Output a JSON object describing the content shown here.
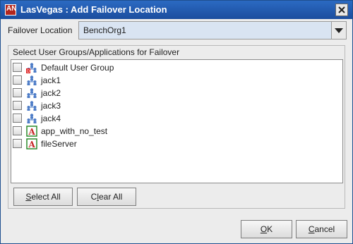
{
  "window": {
    "title": "LasVegas : Add Failover Location",
    "app_icon_letters": "AN"
  },
  "failover_location": {
    "label": "Failover Location",
    "selected_value": "BenchOrg1"
  },
  "groups_panel": {
    "title": "Select User Groups/Applications for Failover",
    "items": [
      {
        "label": "Default User Group",
        "icon": "user-group-default-icon",
        "checked": false
      },
      {
        "label": "jack1",
        "icon": "user-group-icon",
        "checked": false
      },
      {
        "label": "jack2",
        "icon": "user-group-icon",
        "checked": false
      },
      {
        "label": "jack3",
        "icon": "user-group-icon",
        "checked": false
      },
      {
        "label": "jack4",
        "icon": "user-group-icon",
        "checked": false
      },
      {
        "label": "app_with_no_test",
        "icon": "application-icon",
        "checked": false
      },
      {
        "label": "fileServer",
        "icon": "application-icon",
        "checked": false
      }
    ],
    "select_all_label": {
      "mnemonic": "S",
      "rest": "elect All"
    },
    "clear_all_label": {
      "pre": "C",
      "mnemonic": "l",
      "rest": "ear All"
    }
  },
  "footer": {
    "ok_label": {
      "mnemonic": "O",
      "rest": "K"
    },
    "cancel_label": {
      "mnemonic": "C",
      "rest": "ancel"
    }
  },
  "colors": {
    "title_bar": "#1f5bb5",
    "combo_bg": "#d9e4f2",
    "window_bg": "#ececec"
  }
}
